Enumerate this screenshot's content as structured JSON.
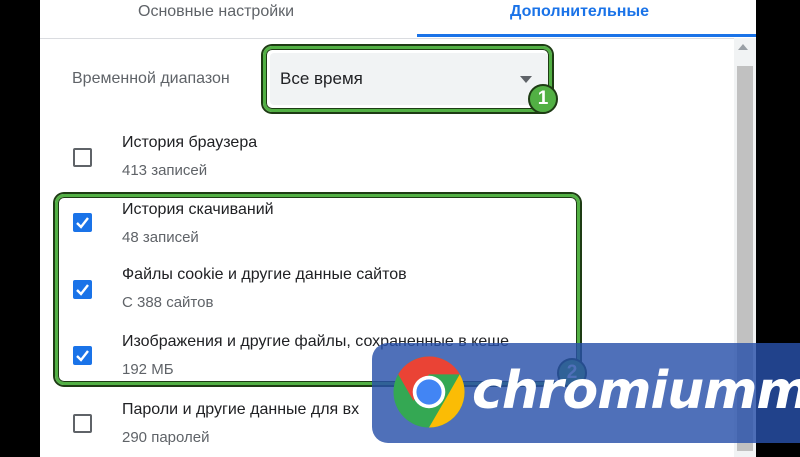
{
  "tabs": {
    "basic": "Основные настройки",
    "advanced": "Дополнительные"
  },
  "time_range": {
    "label": "Временной диапазон",
    "value": "Все время"
  },
  "items": [
    {
      "title": "История браузера",
      "sub": "413 записей",
      "checked": false
    },
    {
      "title": "История скачиваний",
      "sub": "48 записей",
      "checked": true
    },
    {
      "title": "Файлы cookie и другие данные сайтов",
      "sub": "С 388 сайтов",
      "checked": true
    },
    {
      "title": "Изображения и другие файлы, сохраненные в кеше",
      "sub": "192 МБ",
      "checked": true
    },
    {
      "title": "Пароли и другие данные для вх",
      "sub": "290 паролей",
      "checked": false
    }
  ],
  "annotations": {
    "badge1": "1",
    "badge2": "2"
  },
  "watermark": {
    "text": "chromiumm"
  },
  "colors": {
    "accent": "#1a73e8",
    "highlight": "#52b044",
    "watermark_bg": "#2850aa"
  }
}
